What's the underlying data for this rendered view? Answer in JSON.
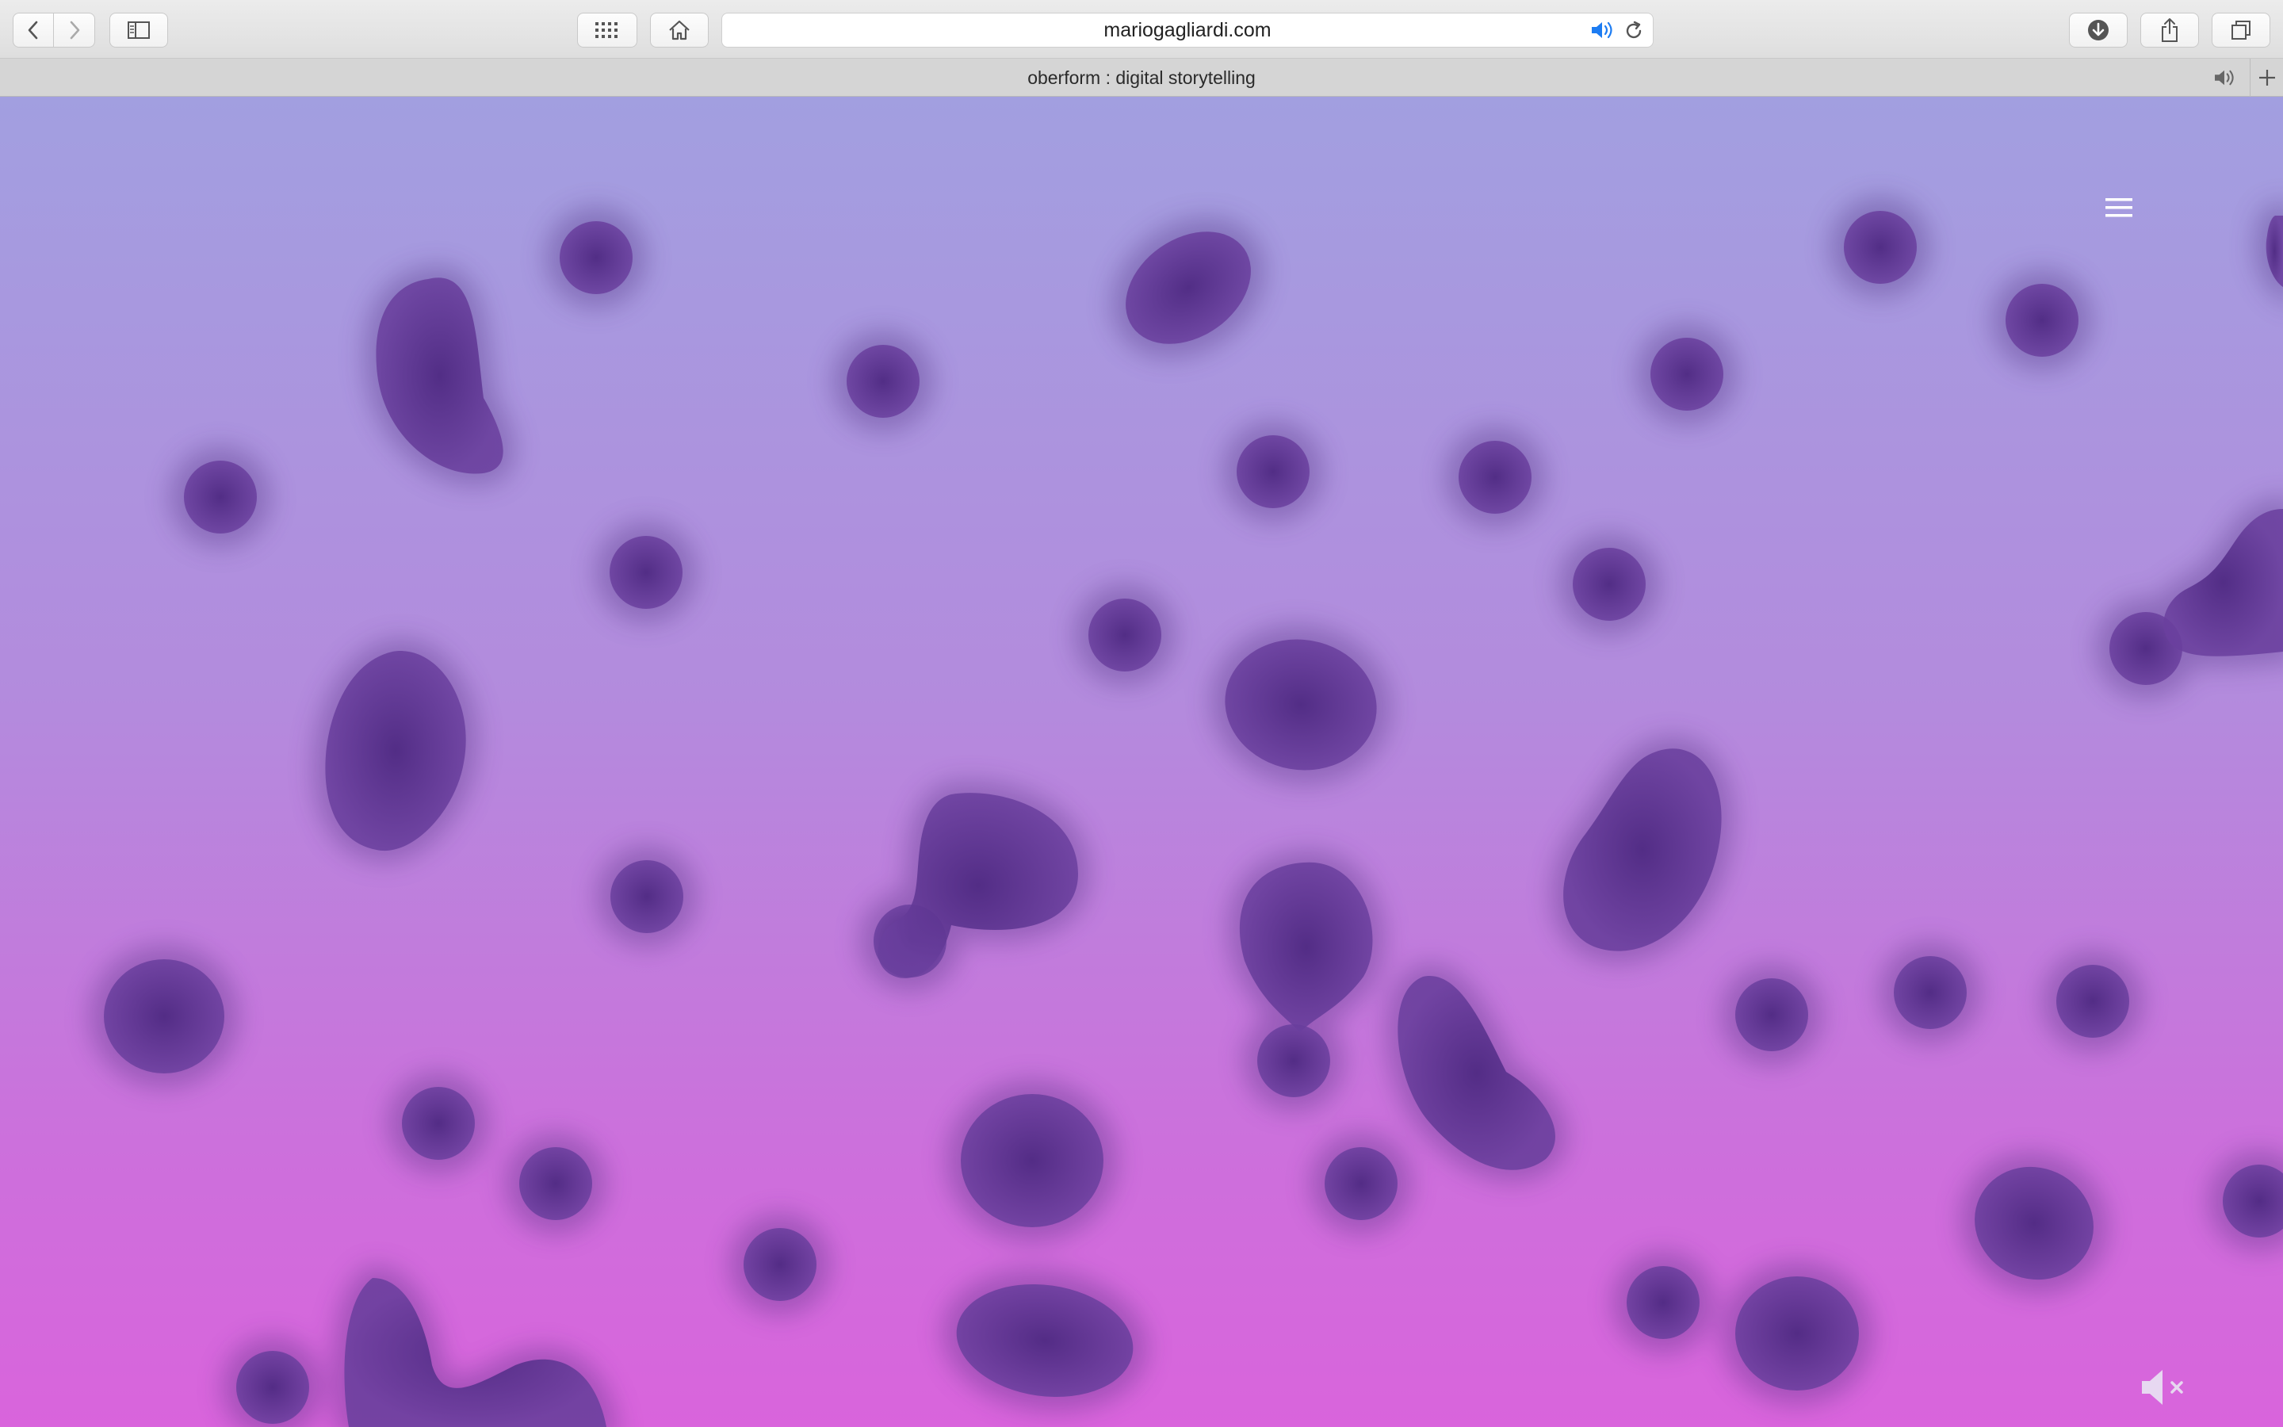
{
  "browser": {
    "address": "mariogagliardi.com",
    "tab_title": "oberform : digital storytelling"
  },
  "colors": {
    "gradient_top": "#a29fe0",
    "gradient_bottom": "#d964dc",
    "blob": "#6a3f9e",
    "menu_icon": "#ffffff",
    "audio_accent": "#1d7cf2"
  },
  "icons": {
    "back": "chevron-left-icon",
    "forward": "chevron-right-icon",
    "sidebar": "sidebar-icon",
    "top_sites": "grid-icon",
    "home": "home-icon",
    "audio": "speaker-icon",
    "reload": "reload-icon",
    "download": "download-icon",
    "share": "share-icon",
    "tabs": "tabs-icon",
    "new_tab": "plus-icon",
    "menu": "hamburger-icon",
    "mute": "speaker-muted-icon"
  }
}
